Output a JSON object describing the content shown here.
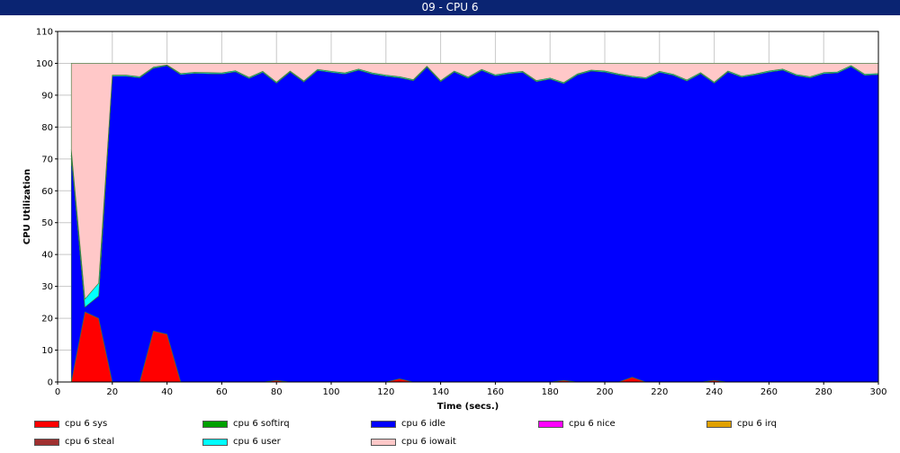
{
  "window": {
    "title": "09 - CPU 6"
  },
  "chart_data": {
    "type": "area",
    "stacked": true,
    "title": "09 - CPU 6",
    "xlabel": "Time (secs.)",
    "ylabel": "CPU Utilization",
    "xlim": [
      0,
      300
    ],
    "ylim": [
      0,
      110
    ],
    "xticks": [
      0,
      20,
      40,
      60,
      80,
      100,
      120,
      140,
      160,
      180,
      200,
      220,
      240,
      260,
      280,
      300
    ],
    "yticks": [
      0,
      10,
      20,
      30,
      40,
      50,
      60,
      70,
      80,
      90,
      100,
      110
    ],
    "grid": true,
    "legend_position": "bottom",
    "x": [
      5,
      10,
      15,
      20,
      25,
      30,
      35,
      40,
      45,
      50,
      55,
      60,
      65,
      70,
      75,
      80,
      85,
      90,
      95,
      100,
      105,
      110,
      115,
      120,
      125,
      130,
      135,
      140,
      145,
      150,
      155,
      160,
      165,
      170,
      175,
      180,
      185,
      190,
      195,
      200,
      205,
      210,
      215,
      220,
      225,
      230,
      235,
      240,
      245,
      250,
      255,
      260,
      265,
      270,
      275,
      280,
      285,
      290,
      295,
      300
    ],
    "series": [
      {
        "name": "cpu 6 sys",
        "color": "#ff0000",
        "values": [
          0,
          22,
          20,
          0,
          0,
          0,
          16,
          15,
          0,
          0,
          0,
          0,
          0,
          0,
          0,
          0.5,
          0,
          0,
          0,
          0,
          0,
          0,
          0,
          0,
          1,
          0,
          0,
          0,
          0,
          0,
          0,
          0,
          0,
          0,
          0,
          0,
          0.5,
          0,
          0,
          0,
          0,
          1.5,
          0,
          0,
          0,
          0,
          0,
          0.5,
          0,
          0,
          0,
          0,
          0,
          0,
          0,
          0,
          0,
          0,
          0,
          0
        ]
      },
      {
        "name": "cpu 6 softirq",
        "color": "#00a000",
        "values": [
          0,
          0,
          0,
          0,
          0,
          0,
          0,
          0,
          0,
          0,
          0,
          0,
          0,
          0,
          0,
          0,
          0,
          0,
          0,
          0,
          0,
          0,
          0,
          0,
          0,
          0,
          0,
          0,
          0,
          0,
          0,
          0,
          0,
          0,
          0,
          0,
          0,
          0,
          0,
          0,
          0,
          0,
          0,
          0,
          0,
          0,
          0,
          0,
          0,
          0,
          0,
          0,
          0,
          0,
          0,
          0,
          0,
          0,
          0,
          0
        ]
      },
      {
        "name": "cpu 6 idle",
        "color": "#0000ff",
        "values": [
          71,
          1.5,
          7,
          96,
          96,
          95.5,
          82.5,
          84.3,
          96.5,
          96.9,
          96.8,
          96.7,
          97.4,
          95.3,
          97.2,
          93.3,
          97.3,
          94.2,
          97.8,
          97.2,
          96.7,
          97.9,
          96.7,
          96,
          94.5,
          94.6,
          98.8,
          94.3,
          97.3,
          95.4,
          97.8,
          96.1,
          96.8,
          97.2,
          94.3,
          95.1,
          93.2,
          96.4,
          97.6,
          97.3,
          96.4,
          94.2,
          95.2,
          97.2,
          96.3,
          94.5,
          96.8,
          93.3,
          97.3,
          95.7,
          96.4,
          97.3,
          97.9,
          96.2,
          95.5,
          96.8,
          97,
          99,
          96.3,
          96.5
        ]
      },
      {
        "name": "cpu 6 nice",
        "color": "#ff00ff",
        "values": [
          0,
          0,
          0,
          0,
          0,
          0,
          0,
          0,
          0,
          0,
          0,
          0,
          0,
          0,
          0,
          0,
          0,
          0,
          0,
          0,
          0,
          0,
          0,
          0,
          0,
          0,
          0,
          0,
          0,
          0,
          0,
          0,
          0,
          0,
          0,
          0,
          0,
          0,
          0,
          0,
          0,
          0,
          0,
          0,
          0,
          0,
          0,
          0,
          0,
          0,
          0,
          0,
          0,
          0,
          0,
          0,
          0,
          0,
          0,
          0
        ]
      },
      {
        "name": "cpu 6 irq",
        "color": "#e0a000",
        "values": [
          0,
          0,
          0,
          0,
          0,
          0,
          0,
          0,
          0,
          0,
          0,
          0,
          0,
          0,
          0,
          0,
          0,
          0,
          0,
          0,
          0,
          0,
          0,
          0,
          0,
          0,
          0,
          0,
          0,
          0,
          0,
          0,
          0,
          0,
          0,
          0,
          0,
          0,
          0,
          0,
          0,
          0,
          0,
          0,
          0,
          0,
          0,
          0,
          0,
          0,
          0,
          0,
          0,
          0,
          0,
          0,
          0,
          0,
          0,
          0
        ]
      },
      {
        "name": "cpu 6 steal",
        "color": "#a03030",
        "values": [
          0,
          0,
          0,
          0,
          0,
          0,
          0,
          0,
          0,
          0,
          0,
          0,
          0,
          0,
          0,
          0,
          0,
          0,
          0,
          0,
          0,
          0,
          0,
          0,
          0,
          0,
          0,
          0,
          0,
          0,
          0,
          0,
          0,
          0,
          0,
          0,
          0,
          0,
          0,
          0,
          0,
          0,
          0,
          0,
          0,
          0,
          0,
          0,
          0,
          0,
          0,
          0,
          0,
          0,
          0,
          0,
          0,
          0,
          0,
          0
        ]
      },
      {
        "name": "cpu 6 user",
        "color": "#00ffff",
        "values": [
          2,
          2.5,
          4,
          0.3,
          0.3,
          0.3,
          0.3,
          0.2,
          0.3,
          0.3,
          0.3,
          0.3,
          0.3,
          0.3,
          0.3,
          0.3,
          0.3,
          0.3,
          0.3,
          0.3,
          0.3,
          0.3,
          0.3,
          0.3,
          0.3,
          0.3,
          0.3,
          0.3,
          0.3,
          0.3,
          0.3,
          0.3,
          0.3,
          0.3,
          0.3,
          0.3,
          0.3,
          0.3,
          0.3,
          0.3,
          0.3,
          0.3,
          0.3,
          0.3,
          0.3,
          0.3,
          0.3,
          0.3,
          0.3,
          0.3,
          0.3,
          0.3,
          0.3,
          0.3,
          0.3,
          0.3,
          0.3,
          0.3,
          0.3,
          0.3
        ]
      },
      {
        "name": "cpu 6 iowait",
        "color": "#ffc8c8",
        "values": [
          27,
          74,
          69,
          3.7,
          3.7,
          4.2,
          1.2,
          0.5,
          3.2,
          2.8,
          2.9,
          3,
          2.3,
          4.4,
          2.5,
          5.9,
          2.4,
          5.5,
          1.9,
          2.5,
          3,
          1.8,
          3,
          3.7,
          4.2,
          5.1,
          0.9,
          5.4,
          2.4,
          4.3,
          1.9,
          3.6,
          2.9,
          2.5,
          5.4,
          4.6,
          6,
          3.3,
          2.1,
          2.4,
          3.3,
          4,
          4.5,
          2.5,
          3.4,
          5.2,
          2.9,
          5.9,
          2.4,
          4,
          3.3,
          2.4,
          1.8,
          3.5,
          4.2,
          2.9,
          2.7,
          0.7,
          3.4,
          3.2
        ]
      }
    ]
  }
}
